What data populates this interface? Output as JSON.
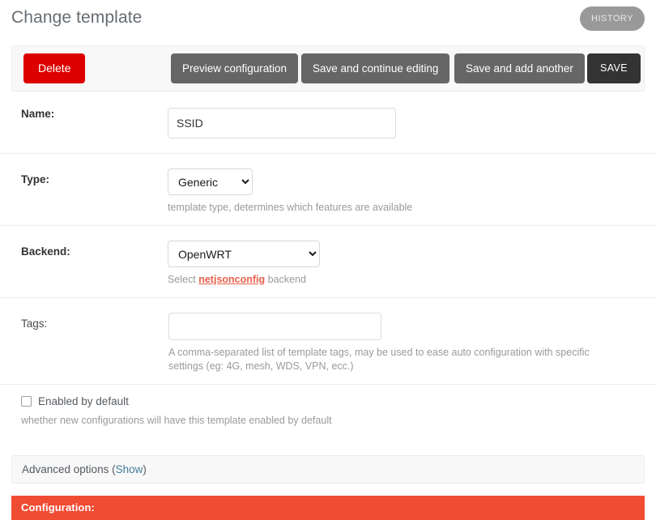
{
  "header": {
    "title": "Change template",
    "history_label": "HISTORY"
  },
  "toolbar": {
    "delete_label": "Delete",
    "preview_label": "Preview configuration",
    "continue_label": "Save and continue editing",
    "another_label": "Save and add another",
    "save_label": "SAVE"
  },
  "form": {
    "name": {
      "label": "Name:",
      "value": "SSID",
      "placeholder": ""
    },
    "type": {
      "label": "Type:",
      "value": "Generic",
      "options": [
        "Generic"
      ],
      "help": "template type, determines which features are available"
    },
    "backend": {
      "label": "Backend:",
      "value": "OpenWRT",
      "options": [
        "OpenWRT"
      ],
      "help_prefix": "Select ",
      "help_link": "netjsonconfig",
      "help_suffix": " backend"
    },
    "tags": {
      "label": "Tags:",
      "value": "",
      "placeholder": "",
      "help": "A comma-separated list of template tags, may be used to ease auto configuration with specific settings (eg: 4G, mesh, WDS, VPN, ecc.)"
    },
    "enabled_by_default": {
      "label": "Enabled by default",
      "checked": false,
      "help": "whether new configurations will have this template enabled by default"
    }
  },
  "advanced": {
    "text_prefix": "Advanced options (",
    "link_label": "Show",
    "text_suffix": ")"
  },
  "configuration": {
    "label": "Configuration:"
  },
  "colors": {
    "delete_red": "#dd0000",
    "button_gray": "#666666",
    "save_dark": "#333333",
    "history_gray": "#999999",
    "config_red": "#f04b33",
    "link_blue": "#447e9b",
    "netjson_red": "#e8604c"
  }
}
